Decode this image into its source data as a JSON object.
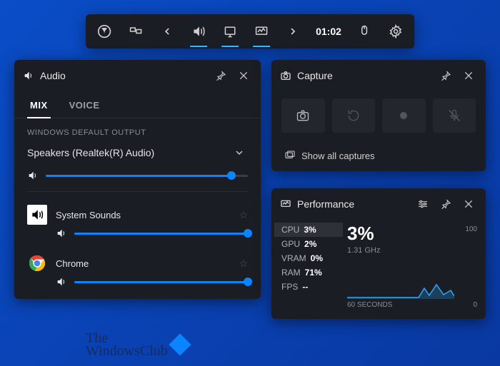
{
  "toolbar": {
    "time": "01:02"
  },
  "audio": {
    "title": "Audio",
    "tabs": [
      "MIX",
      "VOICE"
    ],
    "section_label": "WINDOWS DEFAULT OUTPUT",
    "device": "Speakers (Realtek(R) Audio)",
    "device_volume_pct": 92,
    "apps": [
      {
        "name": "System Sounds",
        "volume_pct": 100,
        "icon": "speaker"
      },
      {
        "name": "Chrome",
        "volume_pct": 100,
        "icon": "chrome"
      }
    ]
  },
  "capture": {
    "title": "Capture",
    "show_all": "Show all captures"
  },
  "performance": {
    "title": "Performance",
    "metrics": [
      {
        "key": "CPU",
        "val": "3%"
      },
      {
        "key": "GPU",
        "val": "2%"
      },
      {
        "key": "VRAM",
        "val": "0%"
      },
      {
        "key": "RAM",
        "val": "71%"
      },
      {
        "key": "FPS",
        "val": "--"
      }
    ],
    "selected_big": "3%",
    "selected_sub": "1.31 GHz",
    "y_max": "100",
    "y_min": "0",
    "x_label": "60 SECONDS"
  },
  "watermark": {
    "line1": "The",
    "line2": "WindowsClub"
  }
}
